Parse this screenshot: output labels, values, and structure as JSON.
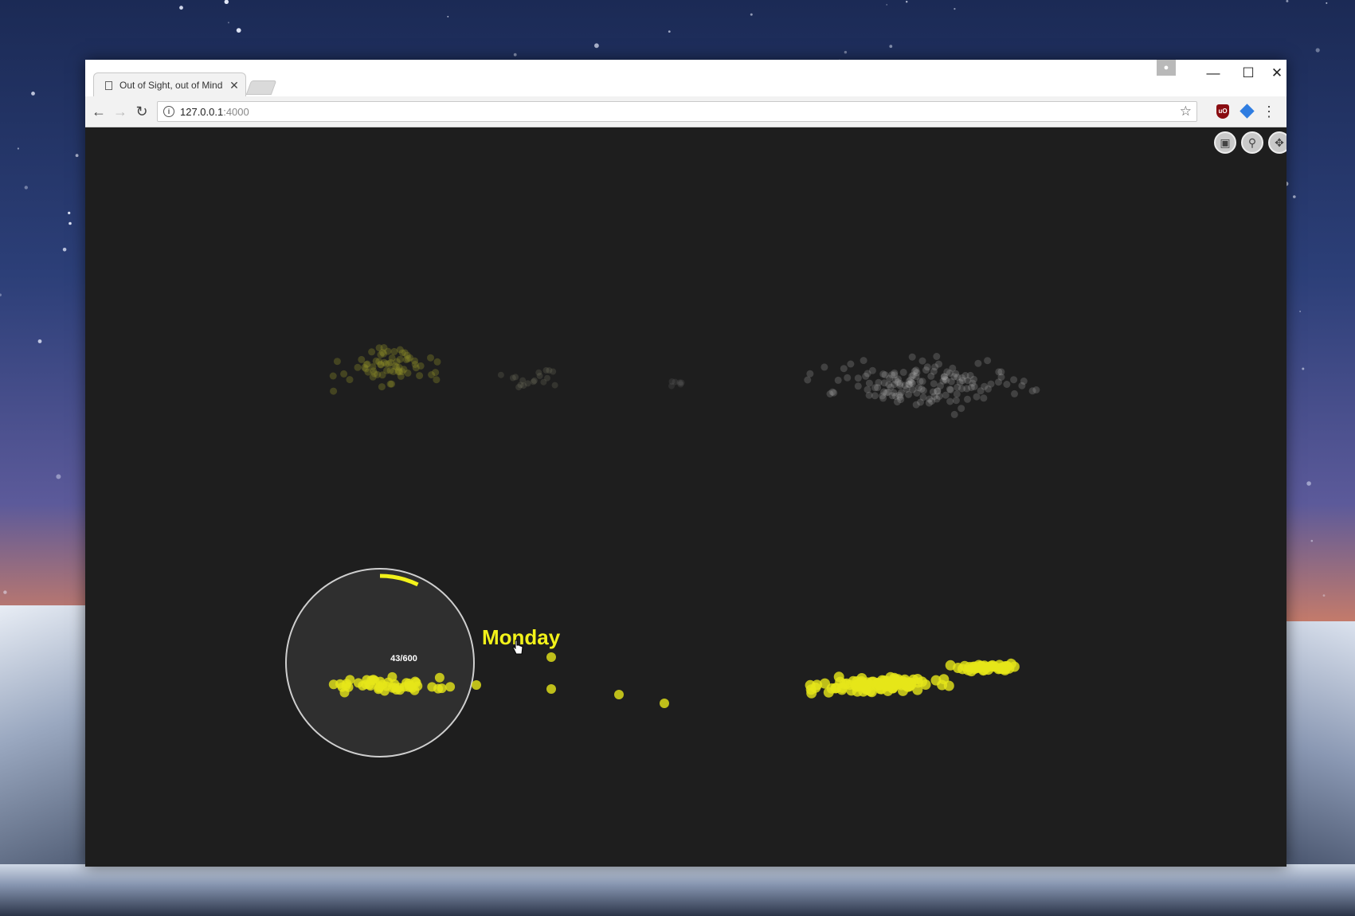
{
  "browser": {
    "tab_title": "Out of Sight, out of Mind",
    "tab_close": "✕",
    "address_host": "127.0.0.1",
    "address_port": ":4000",
    "icons": [
      "page-icon",
      "back-arrow-icon",
      "forward-arrow-icon",
      "reload-icon",
      "info-icon",
      "bookmark-star-icon",
      "ublock-icon",
      "extension-icon",
      "menu-icon",
      "profile-icon",
      "minimize-icon",
      "maximize-icon",
      "close-icon"
    ]
  },
  "visualization": {
    "day_label": "Monday",
    "lens_count": "43/600",
    "lens_progress": 0.0717,
    "accent_color": "#f2f21a",
    "controls": [
      "camera-icon",
      "search-icon",
      "fullscreen-icon"
    ]
  }
}
